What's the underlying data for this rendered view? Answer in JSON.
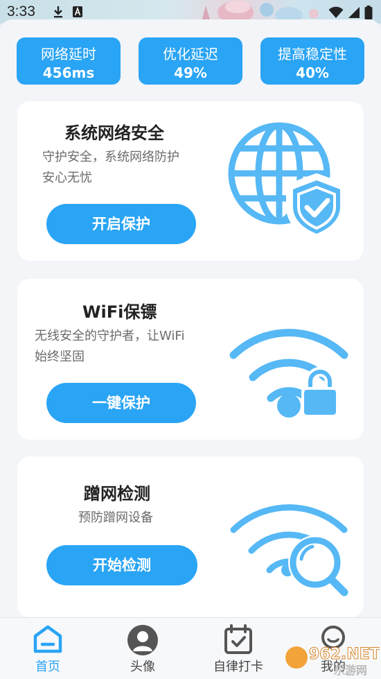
{
  "status_bar": {
    "time": "3:33",
    "icons": [
      "download-icon",
      "text-a-icon",
      "wifi-icon",
      "signal-icon",
      "battery-icon"
    ]
  },
  "stats": [
    {
      "label": "网络延时",
      "value": "456ms"
    },
    {
      "label": "优化延迟",
      "value": "49%"
    },
    {
      "label": "提高稳定性",
      "value": "40%"
    }
  ],
  "cards": [
    {
      "title": "系统网络安全",
      "desc_line1": "守护安全，系统网络防护",
      "desc_line2": "安心无忧",
      "button": "开启保护",
      "icon": "globe-shield-icon"
    },
    {
      "title": "WiFi保镖",
      "desc_line1": "无线安全的守护者，让WiFi",
      "desc_line2": "始终坚固",
      "button": "一键保护",
      "icon": "wifi-lock-icon"
    },
    {
      "title": "蹭网检测",
      "desc_line1": "预防蹭网设备",
      "button": "开始检测",
      "icon": "wifi-search-icon"
    }
  ],
  "nav": [
    {
      "label": "首页",
      "icon": "home-icon",
      "active": true
    },
    {
      "label": "头像",
      "icon": "avatar-icon",
      "active": false
    },
    {
      "label": "自律打卡",
      "icon": "calendar-check-icon",
      "active": false
    },
    {
      "label": "我的",
      "icon": "profile-icon",
      "active": false
    }
  ],
  "watermark": {
    "text_top": "962.NET",
    "text_bottom": "乐游网"
  },
  "colors": {
    "accent": "#2aa4f4",
    "icon_blue": "#56b8f5",
    "background": "#f3f5f8"
  }
}
